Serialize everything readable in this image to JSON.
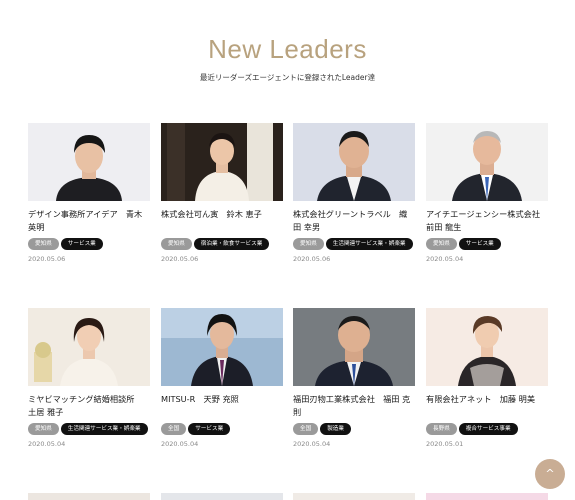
{
  "section": {
    "title": "New Leaders",
    "subtitle": "最近リーダーズエージェントに登録されたLeader達"
  },
  "leaders": [
    {
      "name": "デザイン事務所アイデア　青木 英明",
      "tags": [
        "愛知県",
        "サービス業"
      ],
      "date": "2020.05.06"
    },
    {
      "name": "株式会社可ん寅　鈴木 恵子",
      "tags": [
        "愛知県",
        "宿泊業・飲食サービス業"
      ],
      "date": "2020.05.06"
    },
    {
      "name": "株式会社グリーントラベル　織田 幸男",
      "tags": [
        "愛知県",
        "生活関連サービス業・娯楽業"
      ],
      "date": "2020.05.06"
    },
    {
      "name": "アイチエージェンシー株式会社　前田 龍生",
      "tags": [
        "愛知県",
        "サービス業"
      ],
      "date": "2020.05.04"
    },
    {
      "name": "ミヤビマッチング結婚相談所　土居 雅子",
      "tags": [
        "愛知県",
        "生活関連サービス業・娯楽業"
      ],
      "date": "2020.05.04"
    },
    {
      "name": "MITSU-R　天野 充照",
      "tags": [
        "全国",
        "サービス業"
      ],
      "date": "2020.05.04"
    },
    {
      "name": "福田刃物工業株式会社　福田 克則",
      "tags": [
        "全国",
        "製造業"
      ],
      "date": "2020.05.04"
    },
    {
      "name": "有限会社アネット　加藤 明美",
      "tags": [
        "長野県",
        "複合サービス事業"
      ],
      "date": "2020.05.01"
    }
  ],
  "scroll_top": {
    "icon": "chevron-up-icon",
    "glyph": "^"
  },
  "colors": {
    "title": "#b8a27e",
    "scroll_button": "#c9ad94",
    "tag_region": "#9a9a9a",
    "tag_industry": "#111111"
  }
}
